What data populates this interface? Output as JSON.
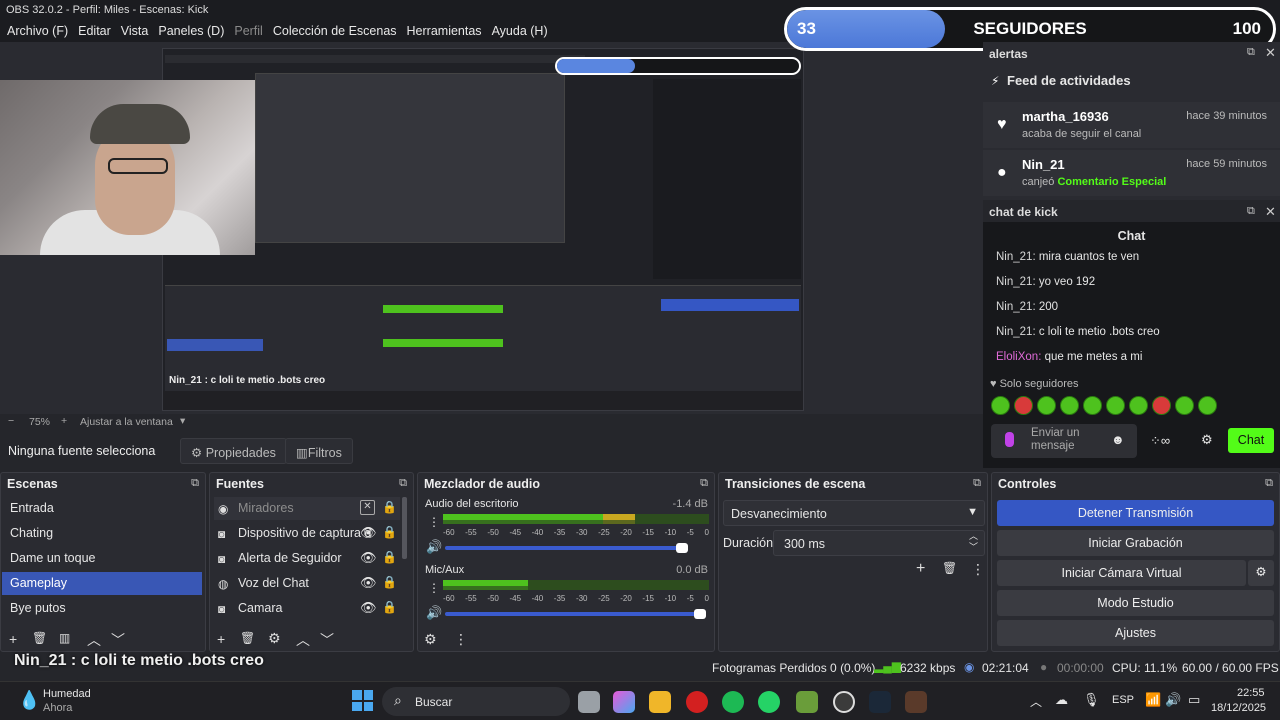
{
  "window": {
    "title": "OBS 32.0.2 - Perfil: Miles - Escenas: Kick"
  },
  "menu": [
    {
      "label": "Archivo (F)"
    },
    {
      "label": "Editar"
    },
    {
      "label": "Vista"
    },
    {
      "label": "Paneles (D)"
    },
    {
      "label": "Perfil"
    },
    {
      "label": "Colección de Escenas"
    },
    {
      "label": "Herramientas"
    },
    {
      "label": "Ayuda (H)"
    }
  ],
  "followers": {
    "current": "33",
    "label": "SEGUIDORES",
    "goal": "100"
  },
  "alerts": {
    "dock_title": "alertas",
    "feed_title": "Feed de actividades",
    "items": [
      {
        "user": "martha_16936",
        "action": "acaba de seguir el canal",
        "time": "hace 39 minutos",
        "icon": "heart-icon"
      },
      {
        "user": "Nin_21",
        "action_prefix": "canjeó",
        "action_highlight": "Comentario Especial",
        "time": "hace 59 minutos",
        "icon": "gift-icon"
      }
    ]
  },
  "chat": {
    "dock_title": "chat de kick",
    "header": "Chat",
    "messages": [
      {
        "user": "Nin_21:",
        "text": " mira cuantos te ven"
      },
      {
        "user": "Nin_21:",
        "text": " yo veo 192"
      },
      {
        "user": "Nin_21:",
        "text": " 200"
      },
      {
        "user": "Nin_21:",
        "text": " c loli te metio .bots creo"
      },
      {
        "user": "EloliXon:",
        "text": " que me metes a mi"
      }
    ],
    "mode": "Solo seguidores",
    "input_placeholder": "Enviar un mensaje",
    "send_label": "Chat"
  },
  "preview": {
    "zoom": "75%",
    "fit_label": "Ajustar a la ventana",
    "mini_overlay_text": "Nin_21 : c loli te metio .bots creo"
  },
  "source_bar": {
    "selection": "Ninguna fuente selecciona",
    "properties": "Propiedades",
    "filters": "Filtros"
  },
  "scenes": {
    "title": "Escenas",
    "items": [
      "Entrada",
      "Chating",
      "Dame un toque",
      "Gameplay",
      "Bye putos"
    ],
    "selected": "Gameplay"
  },
  "sources": {
    "title": "Fuentes",
    "items": [
      {
        "name": "Miradores",
        "disabled": true
      },
      {
        "name": "Dispositivo de captura d",
        "disabled": false
      },
      {
        "name": "Alerta de Seguidor",
        "disabled": false
      },
      {
        "name": "Voz del Chat",
        "disabled": false
      },
      {
        "name": "Camara",
        "disabled": false
      }
    ]
  },
  "mixer": {
    "title": "Mezclador de audio",
    "channels": [
      {
        "name": "Audio del escritorio",
        "db": "-1.4 dB",
        "level": 0.72
      },
      {
        "name": "Mic/Aux",
        "db": "0.0 dB",
        "level": 0.32
      }
    ],
    "scale": [
      "-60",
      "-55",
      "-50",
      "-45",
      "-40",
      "-35",
      "-30",
      "-25",
      "-20",
      "-15",
      "-10",
      "-5",
      "0"
    ]
  },
  "transitions": {
    "title": "Transiciones de escena",
    "type": "Desvanecimiento",
    "duration_label": "Duración",
    "duration": "300 ms"
  },
  "controls": {
    "title": "Controles",
    "stop_stream": "Detener Transmisión",
    "start_recording": "Iniciar Grabación",
    "virtual_cam": "Iniciar Cámara Virtual",
    "studio_mode": "Modo Estudio",
    "settings": "Ajustes"
  },
  "overlay_chat_text": "Nin_21 : c loli te metio .bots creo",
  "status": {
    "dropped": "Fotogramas Perdidos 0 (0.0%)",
    "bitrate": "6232 kbps",
    "stream_time": "02:21:04",
    "rec_time": "00:00:00",
    "cpu": "CPU: 11.1%",
    "fps": "60.00 / 60.00 FPS"
  },
  "taskbar": {
    "weather_title": "Humedad",
    "weather_sub": "Ahora",
    "search": "Buscar",
    "lang": "ESP",
    "time": "22:55",
    "date": "18/12/2025"
  },
  "colors": {
    "accent": "#3557c4",
    "kick_green": "#53fc18"
  }
}
